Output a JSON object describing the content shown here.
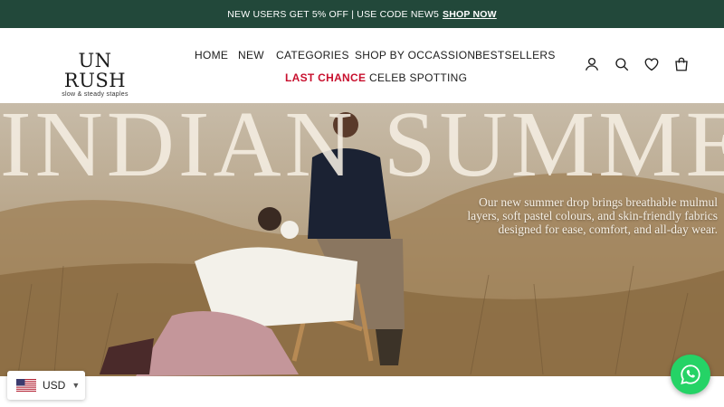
{
  "announcement": {
    "text": "NEW USERS GET 5% OFF | USE CODE NEW5",
    "link": "SHOP NOW"
  },
  "brand": {
    "name": "UN RUSH",
    "tagline": "slow & steady staples"
  },
  "nav": {
    "items": [
      "HOME",
      "NEW",
      "CATEGORIES",
      "SHOP BY OCCASSION",
      "BESTSELLERS"
    ],
    "sale": "LAST CHANCE",
    "celeb": "CELEB SPOTTING"
  },
  "header_icons": [
    "account-icon",
    "search-icon",
    "wishlist-heart-icon",
    "cart-bag-icon"
  ],
  "hero": {
    "title": "INDIAN SUMMER",
    "copy_lines": [
      "Our new summer drop brings breathable mulmul",
      "layers, soft pastel colours, and skin-friendly fabrics",
      "designed for ease, comfort, and all-day wear."
    ]
  },
  "currency": {
    "code": "USD",
    "flag_icon": "us-flag-icon"
  },
  "whatsapp": {
    "icon": "whatsapp-icon",
    "color": "#25d366"
  },
  "colors": {
    "announcement_bg": "#22483a",
    "sale": "#c8102e",
    "whatsapp": "#25d366"
  }
}
